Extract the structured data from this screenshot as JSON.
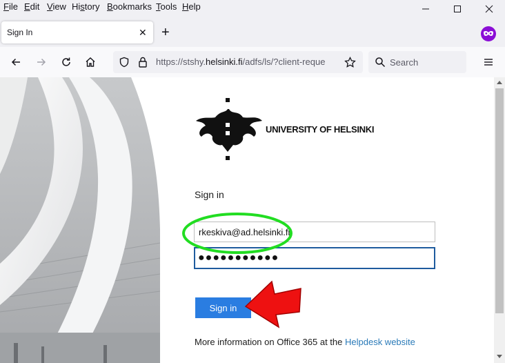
{
  "menu": {
    "items": [
      {
        "label": "File",
        "u": "F",
        "rest": "ile"
      },
      {
        "label": "Edit",
        "u": "E",
        "rest": "dit"
      },
      {
        "label": "View",
        "u": "V",
        "rest": "iew"
      },
      {
        "label": "History",
        "pre": "Hi",
        "u": "s",
        "rest": "tory"
      },
      {
        "label": "Bookmarks",
        "u": "B",
        "rest": "ookmarks"
      },
      {
        "label": "Tools",
        "u": "T",
        "rest": "ools"
      },
      {
        "label": "Help",
        "u": "H",
        "rest": "elp"
      }
    ]
  },
  "tab": {
    "title": "Sign In",
    "close": "✕"
  },
  "newtab": "+",
  "address": {
    "prefix": "https://stshy.",
    "domain": "helsinki.fi",
    "path": "/adfs/ls/?client-reque"
  },
  "search": {
    "label": "Search"
  },
  "page": {
    "org_name": "UNIVERSITY OF HELSINKI",
    "heading": "Sign in",
    "username_value": "rkeskiva@ad.helsinki.fi",
    "password_value": "●●●●●●●●●●●",
    "button_label": "Sign in",
    "info_text": "More information on Office 365 at the ",
    "info_link": "Helpdesk website"
  },
  "colors": {
    "accent": "#2a7de1",
    "highlight_ellipse": "#22dd22",
    "arrow": "#ee1111",
    "extension": "#8b0ed6"
  }
}
